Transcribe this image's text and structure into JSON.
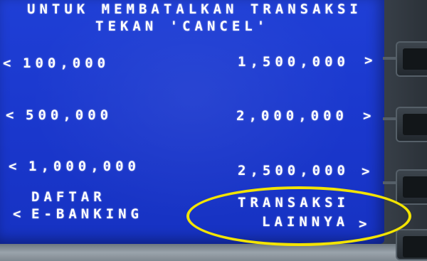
{
  "header": {
    "line1": "UNTUK MEMBATALKAN TRANSAKSI",
    "line2": "TEKAN 'CANCEL'"
  },
  "left_options": [
    {
      "arrow": "<",
      "label": "100,000"
    },
    {
      "arrow": "<",
      "label": "500,000"
    },
    {
      "arrow": "<",
      "label": "1,000,000"
    },
    {
      "arrow": "<",
      "label_line1": "DAFTAR",
      "label_line2": "E-BANKING"
    }
  ],
  "right_options": [
    {
      "arrow": ">",
      "label": "1,500,000"
    },
    {
      "arrow": ">",
      "label": "2,000,000"
    },
    {
      "arrow": ">",
      "label": "2,500,000"
    },
    {
      "arrow": ">",
      "label_line1": "TRANSAKSI",
      "label_line2": "LAINNYA"
    }
  ],
  "colors": {
    "screen_blue": "#1a37cc",
    "text": "#ffffff",
    "highlight_ring": "#f3e400"
  }
}
